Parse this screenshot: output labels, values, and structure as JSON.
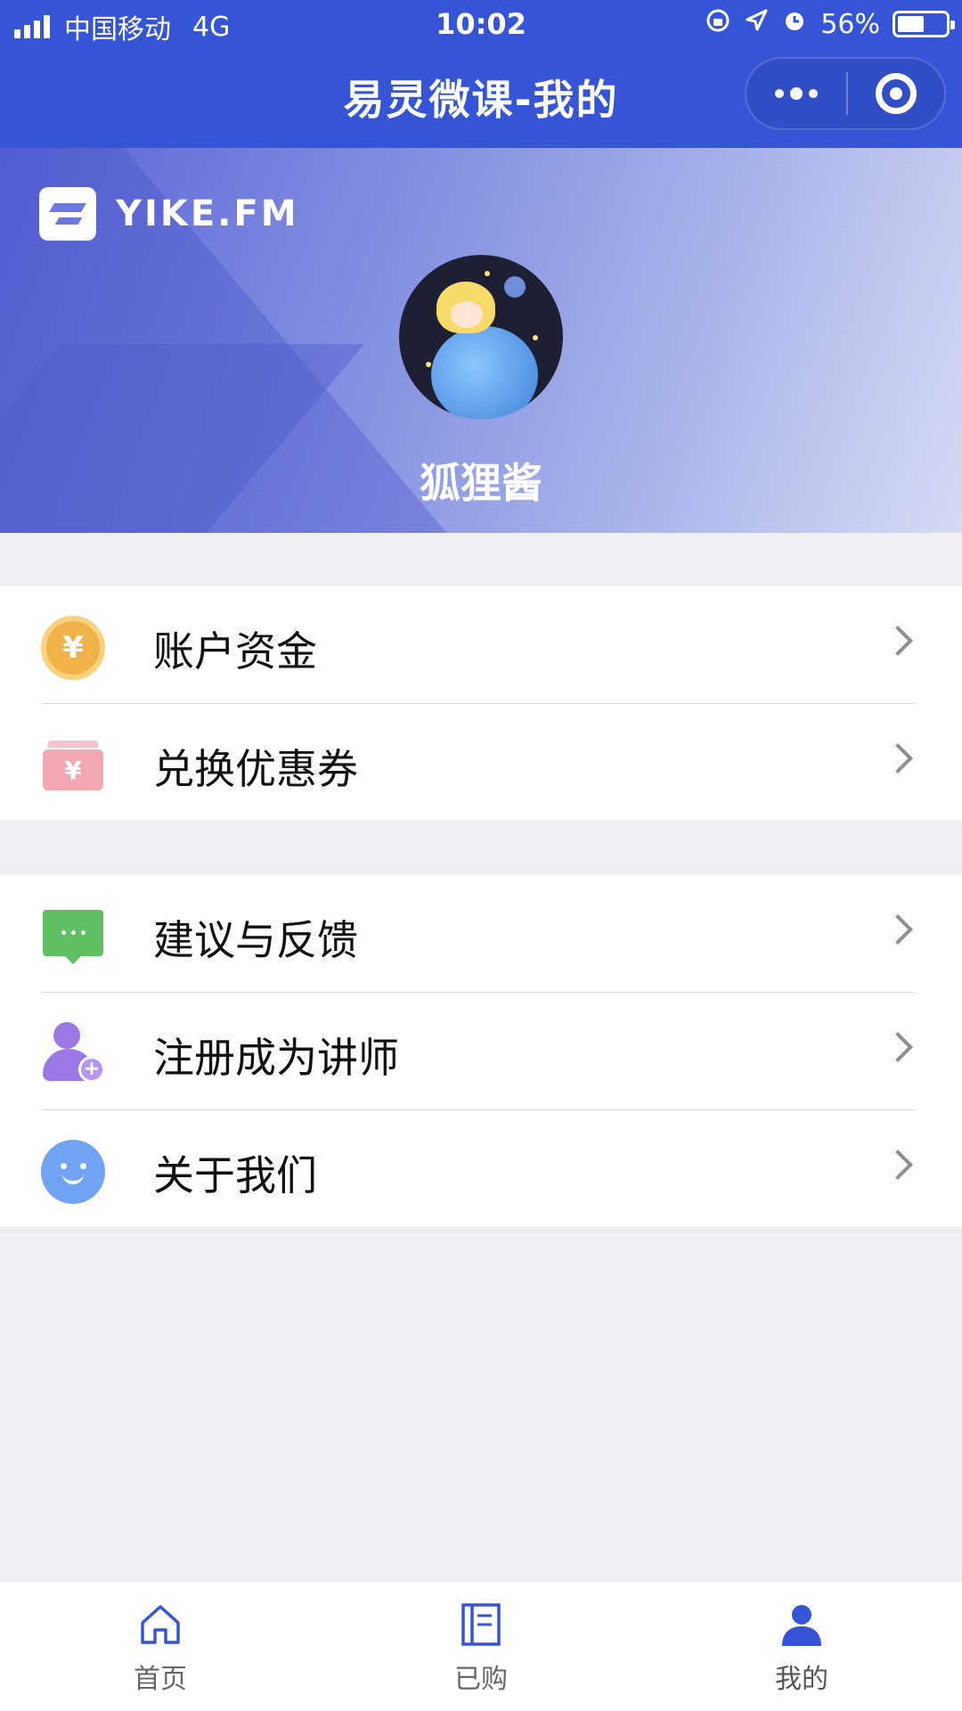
{
  "status_bar": {
    "carrier": "中国移动",
    "network": "4G",
    "time": "10:02",
    "battery": "56%"
  },
  "nav": {
    "title": "易灵微课-我的"
  },
  "header": {
    "logo_text": "YIKE.FM",
    "username": "狐狸酱"
  },
  "menu_group_1": [
    {
      "label": "账户资金",
      "icon": "coin-icon"
    },
    {
      "label": "兑换优惠券",
      "icon": "coupon-icon"
    }
  ],
  "menu_group_2": [
    {
      "label": "建议与反馈",
      "icon": "chat-bubble-icon"
    },
    {
      "label": "注册成为讲师",
      "icon": "add-person-icon"
    },
    {
      "label": "关于我们",
      "icon": "smiley-icon"
    }
  ],
  "tabbar": [
    {
      "label": "首页",
      "icon": "home-icon"
    },
    {
      "label": "已购",
      "icon": "book-icon"
    },
    {
      "label": "我的",
      "icon": "person-icon",
      "active": true
    }
  ],
  "colors": {
    "brand_blue": "#3555d6",
    "tab_active": "#3555d6",
    "background": "#efeff4"
  }
}
